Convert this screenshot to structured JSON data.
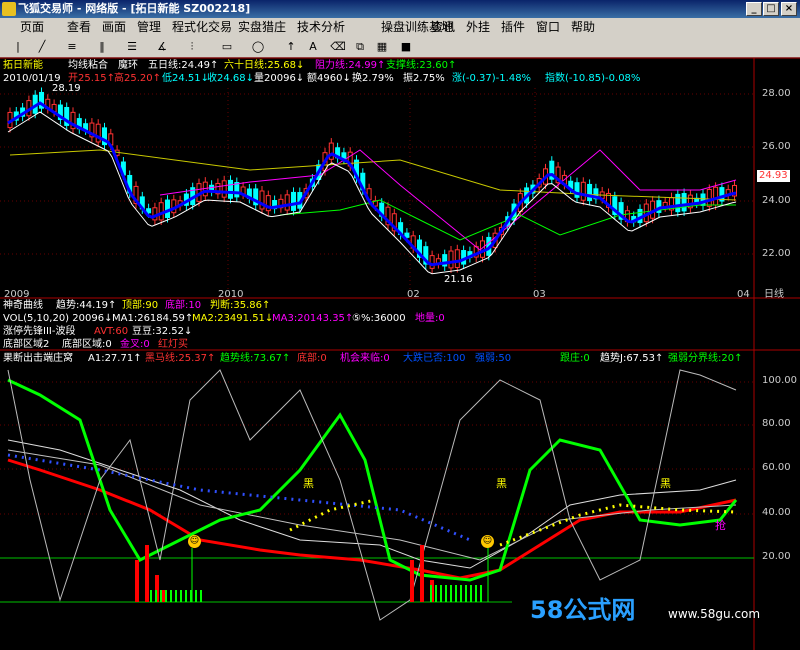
{
  "window": {
    "title": "飞狐交易师 - 网络版 - [拓日新能 SZ002218]"
  },
  "window_controls": {
    "minimize": "_",
    "restore": "□",
    "close": "×"
  },
  "menu": [
    "页面",
    "查看",
    "画面",
    "管理",
    "程式化交易",
    "实盘猎庄",
    "技术分析",
    "操盘训练基地",
    "资讯",
    "外挂",
    "插件",
    "窗口",
    "帮助"
  ],
  "toolbar_icons": [
    "cursor-icon",
    "line-draw-icon",
    "parallel-line-icon",
    "channel-icon",
    "fib-icon",
    "angle-icon",
    "rect-icon",
    "ellipse-icon",
    "arrow-up-icon",
    "text-icon",
    "eraser-icon",
    "palette-icon",
    "save-icon"
  ],
  "price_panel": {
    "stock_name": "拓日新能",
    "ma_title": "均线粘合",
    "indicator_name": "魔环",
    "ma5": "五日线:24.49↑",
    "ma60": "六十日线:25.68↓",
    "resistance": "阻力线:24.99↑",
    "support": "支撑线:23.60↑",
    "date": "2010/01/19",
    "open": "开25.15↑",
    "high": "高25.20↑",
    "low": "低24.51↓",
    "close": "收24.68↓",
    "volume": "量20096↓",
    "amount": "额4960↓",
    "turnover": "换2.79%",
    "amplitude": "振2.75%",
    "change": "涨(-0.37)-1.48%",
    "index": "指数(-10.85)-0.08%",
    "high_mark": "28.19",
    "low_mark": "21.16",
    "current_price": "24.93",
    "y_ticks": [
      "28.00",
      "26.00",
      "24.00",
      "22.00"
    ],
    "x_ticks": [
      "2009",
      "2010",
      "02",
      "03",
      "04"
    ],
    "period": "日线"
  },
  "indicator_lines": {
    "row1": {
      "name": "神奇曲线",
      "trend": "趋势:44.19↑",
      "top": "顶部:90",
      "bottom": "底部:10",
      "judge": "判断:35.86↑"
    },
    "row2": {
      "vol": "VOL(5,10,20) 20096↓",
      "ma1": "MA1:26184.59↑",
      "ma2": "MA2:23491.51↓",
      "ma3": "MA3:20143.35↑",
      "pct": "⑤%:36000",
      "extra": "地量:0"
    },
    "row3": {
      "name": "涨停先锋III-波段",
      "avt": "AVT:60",
      "dou": "豆豆:32.52↓"
    },
    "row4": {
      "a": "底部区域2",
      "b": "底部区域:0",
      "c": "金叉:0",
      "d": "红灯买"
    },
    "row5": {
      "name": "果断出击端庄窝",
      "a1": "A1:27.71↑",
      "heima": "黑马线:25.37↑",
      "trend": "趋势线:73.67↑",
      "bottom": "底部:0",
      "chance": "机会来临:0",
      "big": "大跌已否:100",
      "strong": "强弱:50",
      "follow": "跟庄:0",
      "trendj": "趋势J:67.53↑",
      "boundary": "强弱分界线:20↑"
    }
  },
  "lower_panel": {
    "y_ticks": [
      "100.00",
      "80.00",
      "60.00",
      "40.00",
      "20.00"
    ],
    "labels": [
      "黑",
      "黑",
      "黑",
      "抢"
    ]
  },
  "watermark": {
    "text": "58公式网",
    "url": "www.58gu.com"
  },
  "colors": {
    "up": "#ff3232",
    "down": "#00ffff",
    "ma5": "#ffffff",
    "ma_blue": "#0000ff",
    "ma_yellow": "#c8c800",
    "ma_magenta": "#ff00ff",
    "green": "#00ff00",
    "red": "#ff0000"
  }
}
